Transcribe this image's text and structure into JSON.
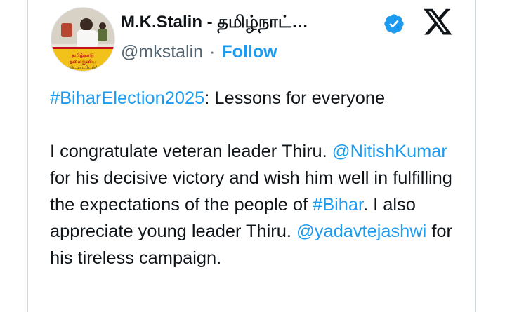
{
  "author": {
    "display_name": "M.K.Stalin - தமிழ்நாட்…",
    "handle": "@mkstalin",
    "separator": "·",
    "follow_label": "Follow",
    "avatar_caption": "தமிழ்நாடு தலைகுனிய விடமாட்டேன்!",
    "verified": true
  },
  "tweet": {
    "hashtag_election": "#BiharElection2025",
    "line1_rest": ": Lessons for everyone",
    "p2_part1": "I congratulate veteran leader Thiru. ",
    "mention_nitish": "@NitishKumar",
    "p2_part2": " for his decisive victory and wish him well in fulfilling the expectations of the people of ",
    "hashtag_bihar": "#Bihar",
    "p2_part3": ". I also appreciate young leader Thiru. ",
    "mention_tejashwi": "@yadavtejashwi",
    "p2_part4": " for his tireless campaign."
  },
  "colors": {
    "link": "#1d9bf0",
    "text": "#0f1419",
    "secondary": "#536471",
    "border": "#cfd9de",
    "avatar_banner": "#f2c21b"
  },
  "icons": {
    "verified": "verified-badge-icon",
    "platform": "x-logo-icon"
  }
}
